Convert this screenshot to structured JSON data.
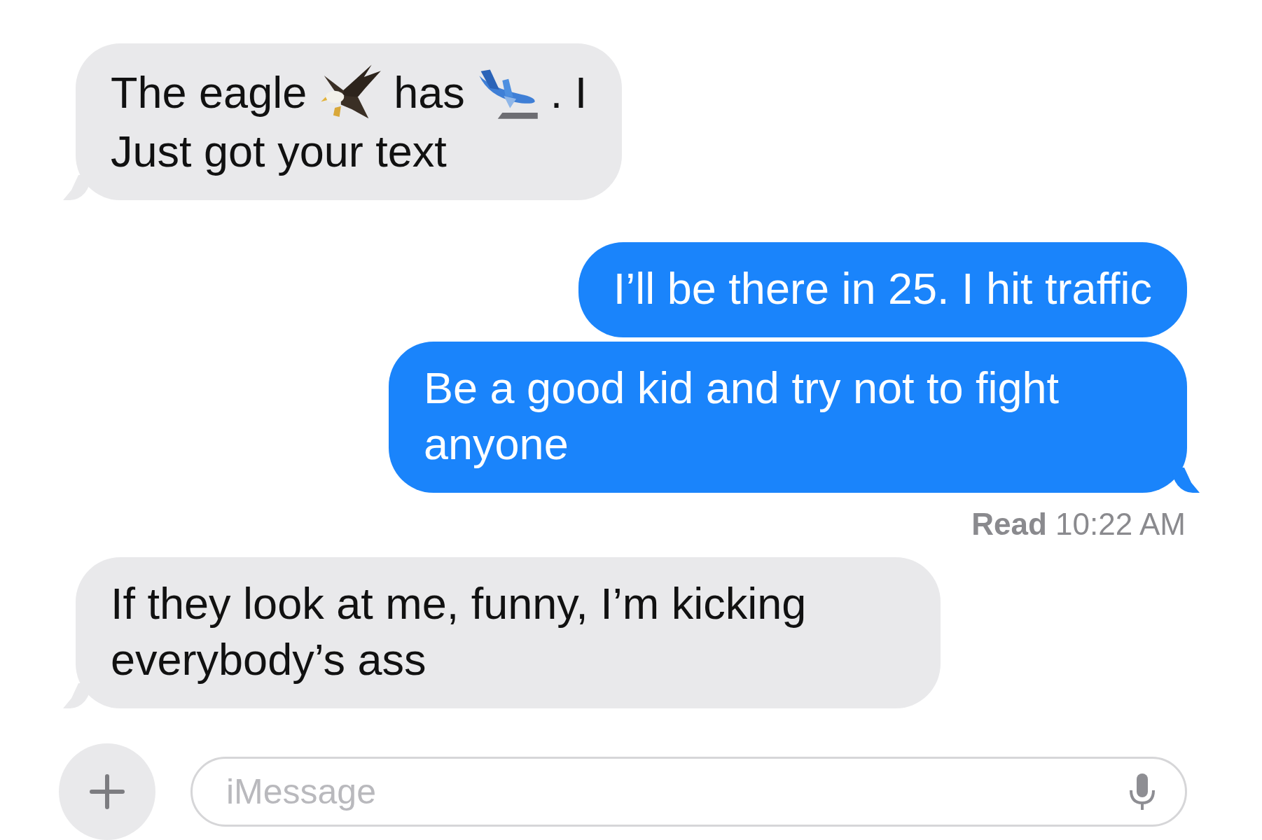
{
  "messages": [
    {
      "kind": "received",
      "tail": true,
      "lines": [
        [
          {
            "kind": "text",
            "text": "The eagle"
          },
          {
            "kind": "eagle"
          },
          {
            "kind": "text",
            "text": "has"
          },
          {
            "kind": "airplane"
          },
          {
            "kind": "text",
            "text": ". I"
          }
        ],
        [
          {
            "kind": "text",
            "text": "Just got your text"
          }
        ]
      ]
    },
    {
      "kind": "sent",
      "tail": false,
      "text": "I’ll be there in 25. I hit traffic"
    },
    {
      "kind": "sent",
      "tail": true,
      "text": "Be a good kid and try not to fight anyone"
    },
    {
      "kind": "receipt",
      "text": "**Read** 10:22 AM"
    },
    {
      "kind": "received",
      "tail": true,
      "text": "If they look at me, funny, I’m kicking everybody’s ass"
    }
  ],
  "composer": {
    "placeholder": "iMessage"
  }
}
